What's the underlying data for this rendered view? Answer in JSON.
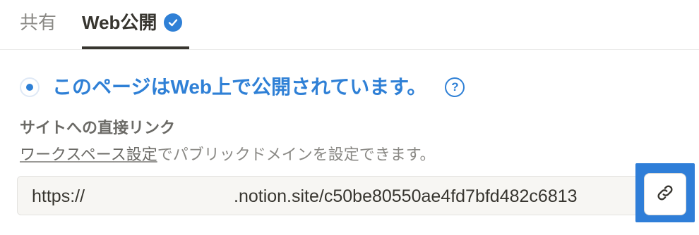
{
  "tabs": [
    {
      "label": "共有",
      "active": false
    },
    {
      "label": "Web公開",
      "active": true
    }
  ],
  "publish_status": {
    "text": "このページはWeb上で公開されています。",
    "help_icon": "question-circle-icon",
    "help_glyph": "?"
  },
  "direct_link": {
    "heading": "サイトへの直接リンク",
    "hint_link": "ワークスペース設定",
    "hint_rest": "でパブリックドメインを設定できます。"
  },
  "url": {
    "prefix": "https://",
    "suffix": ".notion.site/c50be80550ae4fd7bfd482c6813"
  },
  "copy_button": {
    "icon": "link-icon"
  },
  "colors": {
    "accent": "#2f80d6",
    "highlight": "#2f7ed8",
    "text": "#37352f",
    "muted": "#8a8985"
  }
}
